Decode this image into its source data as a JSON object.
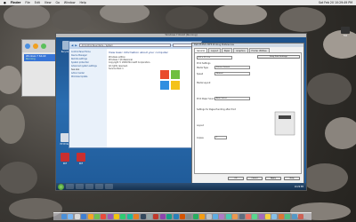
{
  "menubar": {
    "apple": "",
    "items": [
      "Finder",
      "File",
      "Edit",
      "View",
      "Go",
      "Window",
      "Help"
    ],
    "clock": "Sat Feb 20  10:29:49 PM"
  },
  "desktop_icons": [
    {
      "label": "FOX"
    }
  ],
  "vm_manager": {
    "vm_name": "Windows 7 64-bit",
    "vm_status": "Running"
  },
  "win7": {
    "window_title": "Windows 7 64-bit [Running]",
    "desktop_icons": [
      {
        "label": "Recycle Bin",
        "color": "#9fb7d2"
      },
      {
        "label": "HP Printer",
        "color": "#d7dde6"
      },
      {
        "label": "ACR",
        "color": "#d63a3a"
      },
      {
        "label": "PDF",
        "color": "#c92f2f"
      },
      {
        "label": "PDF",
        "color": "#c92f2f"
      }
    ],
    "control_panel": {
      "address": "All Control Panel Items › System",
      "sidebar": [
        "Control Panel Home",
        "Device Manager",
        "Remote settings",
        "System protection",
        "Advanced system settings",
        "",
        "See also",
        "Action Center",
        "Windows Update"
      ],
      "heading": "View basic information about your computer",
      "lines": [
        "Windows edition",
        "Windows 7 Professional",
        "Copyright © 2009 Microsoft Corporation.",
        "All rights reserved.",
        "Service Pack 1"
      ]
    },
    "printer_dialog": {
      "title": "Dell 2335dn MFP Printing Preferences",
      "tabs": [
        "General",
        "Layout",
        "Paper",
        "Graphics",
        "Printer Utilities"
      ],
      "buttons": [
        "Easy Print Settings"
      ],
      "labels": [
        "Print Settings",
        "Media Type",
        "Speed",
        "Media Layout",
        "Print Paper Source",
        "Settings for Pages Handling after Print",
        "Layout",
        "Copies"
      ],
      "field_values": [
        "8.5 x 11.0 in",
        "Printer Default",
        "Normal",
        "Auto Select",
        "1"
      ],
      "dialog_buttons": [
        "OK",
        "Cancel",
        "Apply",
        "Help"
      ]
    },
    "taskbar": {
      "clock": "10:29 PM"
    }
  },
  "dock_colors": [
    "#4a90d9",
    "#7ab8f5",
    "#d9d9d9",
    "#3e7fd3",
    "#f5a623",
    "#6fbf4f",
    "#e94b3c",
    "#9b59b6",
    "#f1c40f",
    "#2ecc71",
    "#1abc9c",
    "#e67e22",
    "#34495e",
    "#95a5a6",
    "#c0392b",
    "#8e44ad",
    "#16a085",
    "#2980b9",
    "#d35400",
    "#7f8c8d",
    "#27ae60",
    "#f39c12",
    "#bdc3c7",
    "#5dade2",
    "#af7ac5",
    "#48c9b0",
    "#eb984e",
    "#5d6d7e",
    "#ec7063",
    "#58d68d",
    "#a569bd",
    "#f4d03f",
    "#85c1e9",
    "#dc7633",
    "#52be80",
    "#5499c7",
    "#cd6155"
  ]
}
